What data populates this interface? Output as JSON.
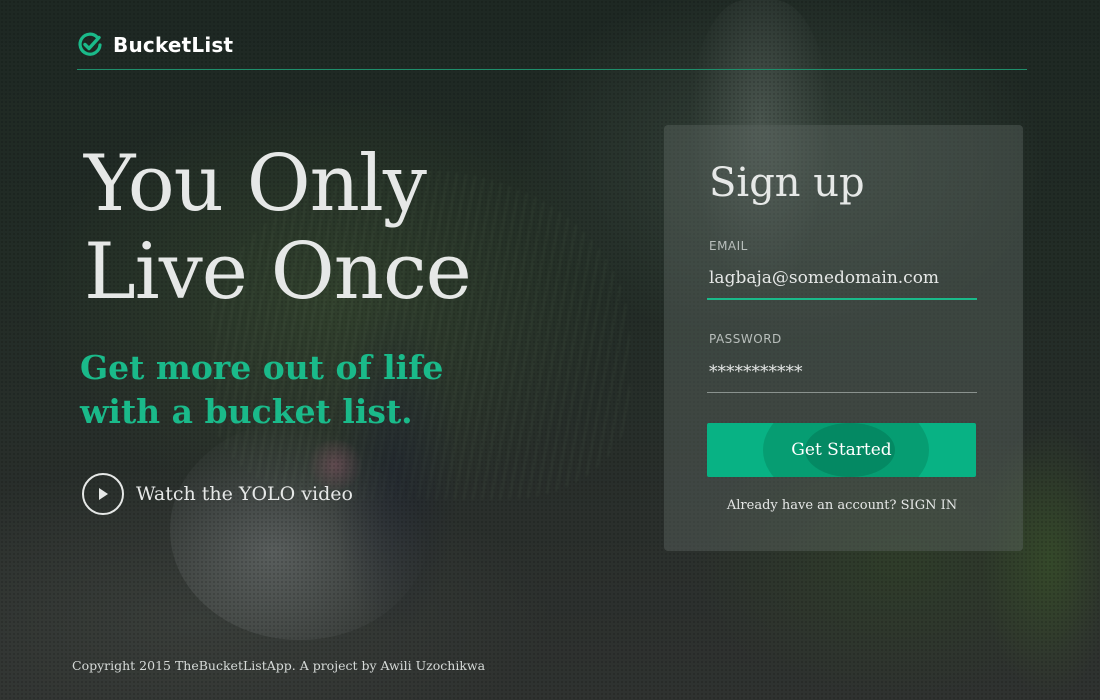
{
  "brand": {
    "name": "BucketList",
    "accent_color": "#1aba8a"
  },
  "hero": {
    "title_line1": "You Only",
    "title_line2": "Live Once",
    "subtitle_line1": "Get more out of life",
    "subtitle_line2": "with a bucket list.",
    "video_link_label": "Watch the YOLO video"
  },
  "signup": {
    "title": "Sign up",
    "email_label": "EMAIL",
    "email_value": "lagbaja@somedomain.com",
    "password_label": "PASSWORD",
    "password_value": "***********",
    "submit_label": "Get Started",
    "signin_prompt": "Already have an account?",
    "signin_link": "SIGN IN"
  },
  "footer": {
    "copyright": "Copyright 2015 TheBucketListApp. A project by Awili Uzochikwa"
  },
  "icons": {
    "logo": "check-circle-icon",
    "video": "play-icon"
  }
}
